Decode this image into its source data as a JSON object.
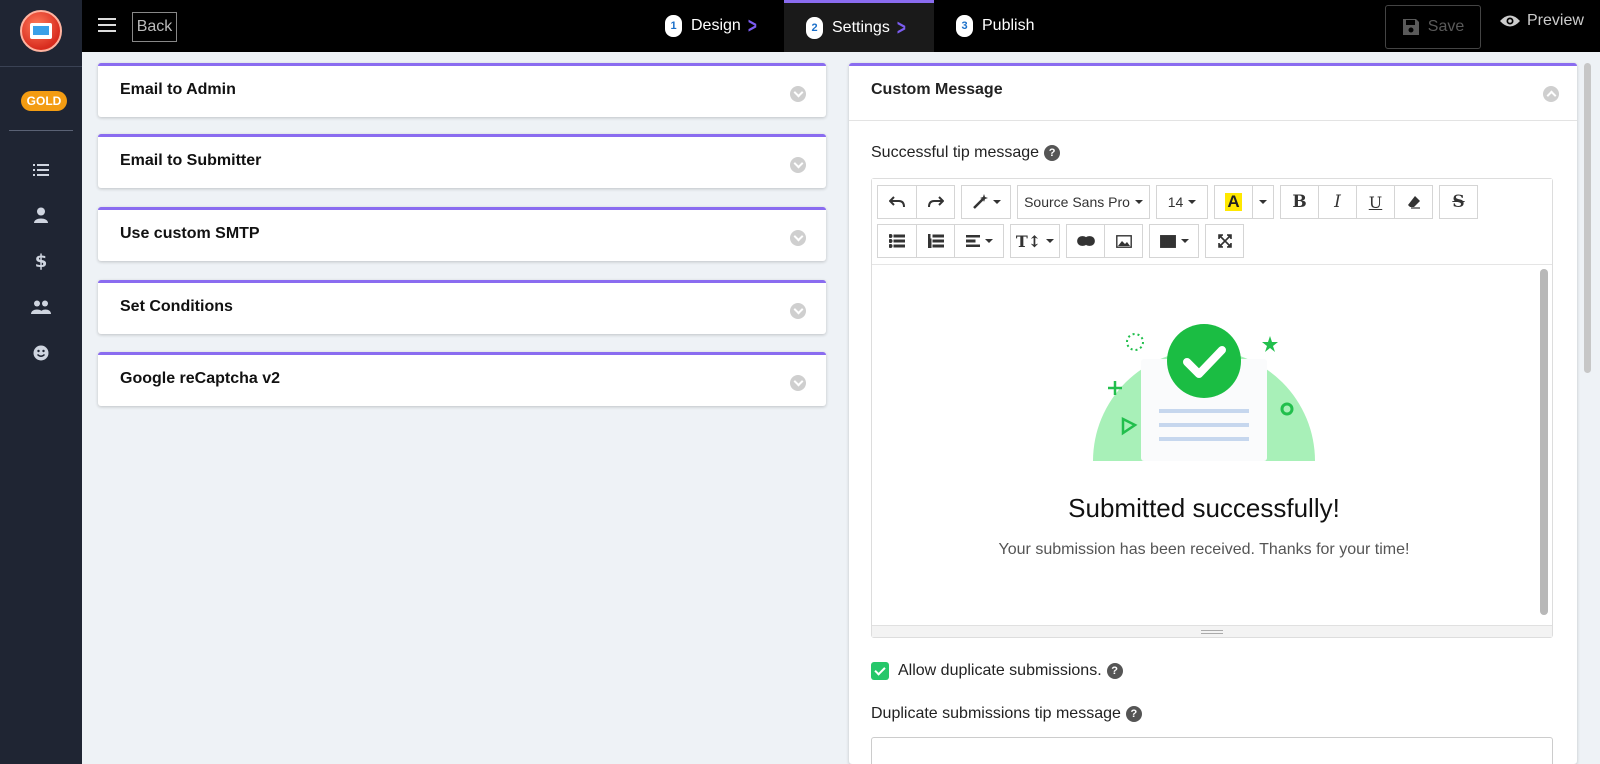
{
  "sidebar": {
    "badge": "GOLD",
    "icons": [
      "list-icon",
      "user-icon",
      "dollar-icon",
      "users-icon",
      "smile-icon"
    ]
  },
  "topbar": {
    "back_label": "Back",
    "steps": [
      {
        "num": "1",
        "label": "Design"
      },
      {
        "num": "2",
        "label": "Settings"
      },
      {
        "num": "3",
        "label": "Publish"
      }
    ],
    "active_step": "Settings",
    "save_label": "Save",
    "preview_label": "Preview"
  },
  "left_panels": [
    {
      "title": "Email to Admin"
    },
    {
      "title": "Email to Submitter"
    },
    {
      "title": "Use custom SMTP"
    },
    {
      "title": "Set Conditions"
    },
    {
      "title": "Google reCaptcha v2"
    }
  ],
  "custom_message": {
    "title": "Custom Message",
    "tip_label": "Successful tip message",
    "toolbar": {
      "font_name": "Source Sans Pro",
      "font_size": "14"
    },
    "content": {
      "heading": "Submitted successfully!",
      "text": "Your submission has been received. Thanks for your time!"
    },
    "allow_duplicate_label": "Allow duplicate submissions.",
    "allow_duplicate_checked": true,
    "duplicate_tip_label": "Duplicate submissions tip message"
  },
  "colors": {
    "accent": "#8a6cf0",
    "sidebar_bg": "#1f2533",
    "gold_badge": "#f39c12",
    "success_green": "#26c76a"
  }
}
